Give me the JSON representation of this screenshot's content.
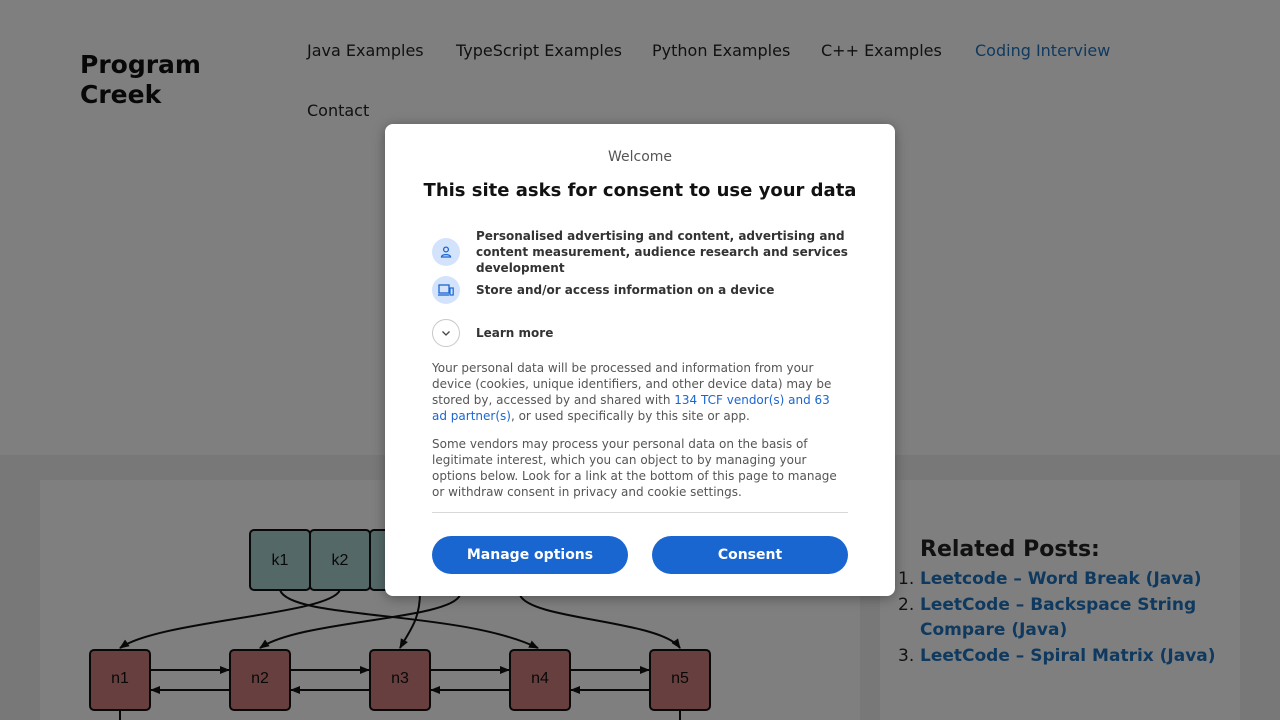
{
  "site": {
    "logo": "Program Creek",
    "nav": [
      {
        "label": "Java Examples"
      },
      {
        "label": "TypeScript Examples"
      },
      {
        "label": "Python Examples"
      },
      {
        "label": "C++ Examples"
      },
      {
        "label": "Coding Interview"
      },
      {
        "label": "Contact"
      }
    ]
  },
  "diagram": {
    "keys": [
      "k1",
      "k2"
    ],
    "nodes": [
      "n1",
      "n2",
      "n3",
      "n4",
      "n5"
    ]
  },
  "related": {
    "title": "Related Posts:",
    "items": [
      {
        "num": "1.",
        "title": "Leetcode – Word Break (Java)"
      },
      {
        "num": "2.",
        "title": "LeetCode – Backspace String Compare (Java)"
      },
      {
        "num": "3.",
        "title": "LeetCode – Spiral Matrix (Java)"
      }
    ]
  },
  "consent": {
    "welcome": "Welcome",
    "title": "This site asks for consent to use your data",
    "purposes": [
      {
        "icon": "person-icon",
        "text": "Personalised advertising and content, advertising and content measurement, audience research and services development"
      },
      {
        "icon": "devices-icon",
        "text": "Store and/or access information on a device"
      }
    ],
    "learn_more": "Learn more",
    "para1_before": "Your personal data will be processed and information from your device (cookies, unique identifiers, and other device data) may be stored by, accessed by and shared with ",
    "para1_link": "134 TCF vendor(s) and 63 ad partner(s)",
    "para1_after": ", or used specifically by this site or app.",
    "para2": "Some vendors may process your personal data on the basis of legitimate interest, which you can object to by managing your options below. Look for a link at the bottom of this page to manage or withdraw consent in privacy and cookie settings.",
    "manage_label": "Manage options",
    "consent_label": "Consent"
  },
  "colors": {
    "accent": "#1a66d1",
    "link": "#1e73be",
    "key_fill": "#a9d0d0",
    "node_fill": "#d07f7f"
  }
}
